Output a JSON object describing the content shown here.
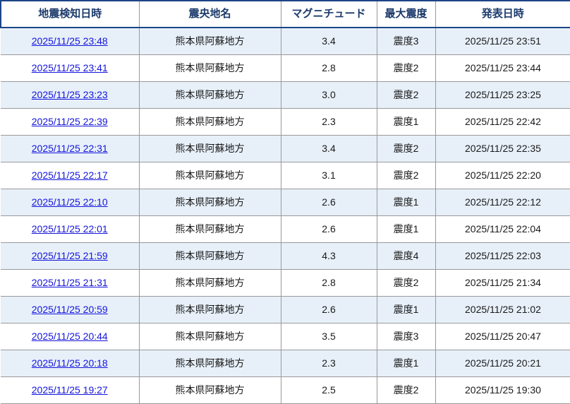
{
  "table": {
    "headers": [
      "地震検知日時",
      "震央地名",
      "マグニチュード",
      "最大震度",
      "発表日時"
    ],
    "rows": [
      {
        "detected": "2025/11/25 23:48",
        "epicenter": "熊本県阿蘇地方",
        "magnitude": "3.4",
        "intensity": "震度3",
        "announced": "2025/11/25 23:51"
      },
      {
        "detected": "2025/11/25 23:41",
        "epicenter": "熊本県阿蘇地方",
        "magnitude": "2.8",
        "intensity": "震度2",
        "announced": "2025/11/25 23:44"
      },
      {
        "detected": "2025/11/25 23:23",
        "epicenter": "熊本県阿蘇地方",
        "magnitude": "3.0",
        "intensity": "震度2",
        "announced": "2025/11/25 23:25"
      },
      {
        "detected": "2025/11/25 22:39",
        "epicenter": "熊本県阿蘇地方",
        "magnitude": "2.3",
        "intensity": "震度1",
        "announced": "2025/11/25 22:42"
      },
      {
        "detected": "2025/11/25 22:31",
        "epicenter": "熊本県阿蘇地方",
        "magnitude": "3.4",
        "intensity": "震度2",
        "announced": "2025/11/25 22:35"
      },
      {
        "detected": "2025/11/25 22:17",
        "epicenter": "熊本県阿蘇地方",
        "magnitude": "3.1",
        "intensity": "震度2",
        "announced": "2025/11/25 22:20"
      },
      {
        "detected": "2025/11/25 22:10",
        "epicenter": "熊本県阿蘇地方",
        "magnitude": "2.6",
        "intensity": "震度1",
        "announced": "2025/11/25 22:12"
      },
      {
        "detected": "2025/11/25 22:01",
        "epicenter": "熊本県阿蘇地方",
        "magnitude": "2.6",
        "intensity": "震度1",
        "announced": "2025/11/25 22:04"
      },
      {
        "detected": "2025/11/25 21:59",
        "epicenter": "熊本県阿蘇地方",
        "magnitude": "4.3",
        "intensity": "震度4",
        "announced": "2025/11/25 22:03"
      },
      {
        "detected": "2025/11/25 21:31",
        "epicenter": "熊本県阿蘇地方",
        "magnitude": "2.8",
        "intensity": "震度2",
        "announced": "2025/11/25 21:34"
      },
      {
        "detected": "2025/11/25 20:59",
        "epicenter": "熊本県阿蘇地方",
        "magnitude": "2.6",
        "intensity": "震度1",
        "announced": "2025/11/25 21:02"
      },
      {
        "detected": "2025/11/25 20:44",
        "epicenter": "熊本県阿蘇地方",
        "magnitude": "3.5",
        "intensity": "震度3",
        "announced": "2025/11/25 20:47"
      },
      {
        "detected": "2025/11/25 20:18",
        "epicenter": "熊本県阿蘇地方",
        "magnitude": "2.3",
        "intensity": "震度1",
        "announced": "2025/11/25 20:21"
      },
      {
        "detected": "2025/11/25 19:27",
        "epicenter": "熊本県阿蘇地方",
        "magnitude": "2.5",
        "intensity": "震度2",
        "announced": "2025/11/25 19:30"
      }
    ]
  },
  "colors": {
    "header_text": "#1b3a6b",
    "header_border": "#1c4587",
    "row_alt_bg": "#e7f0f9",
    "grid_line": "#999999",
    "link": "#1414dc"
  }
}
